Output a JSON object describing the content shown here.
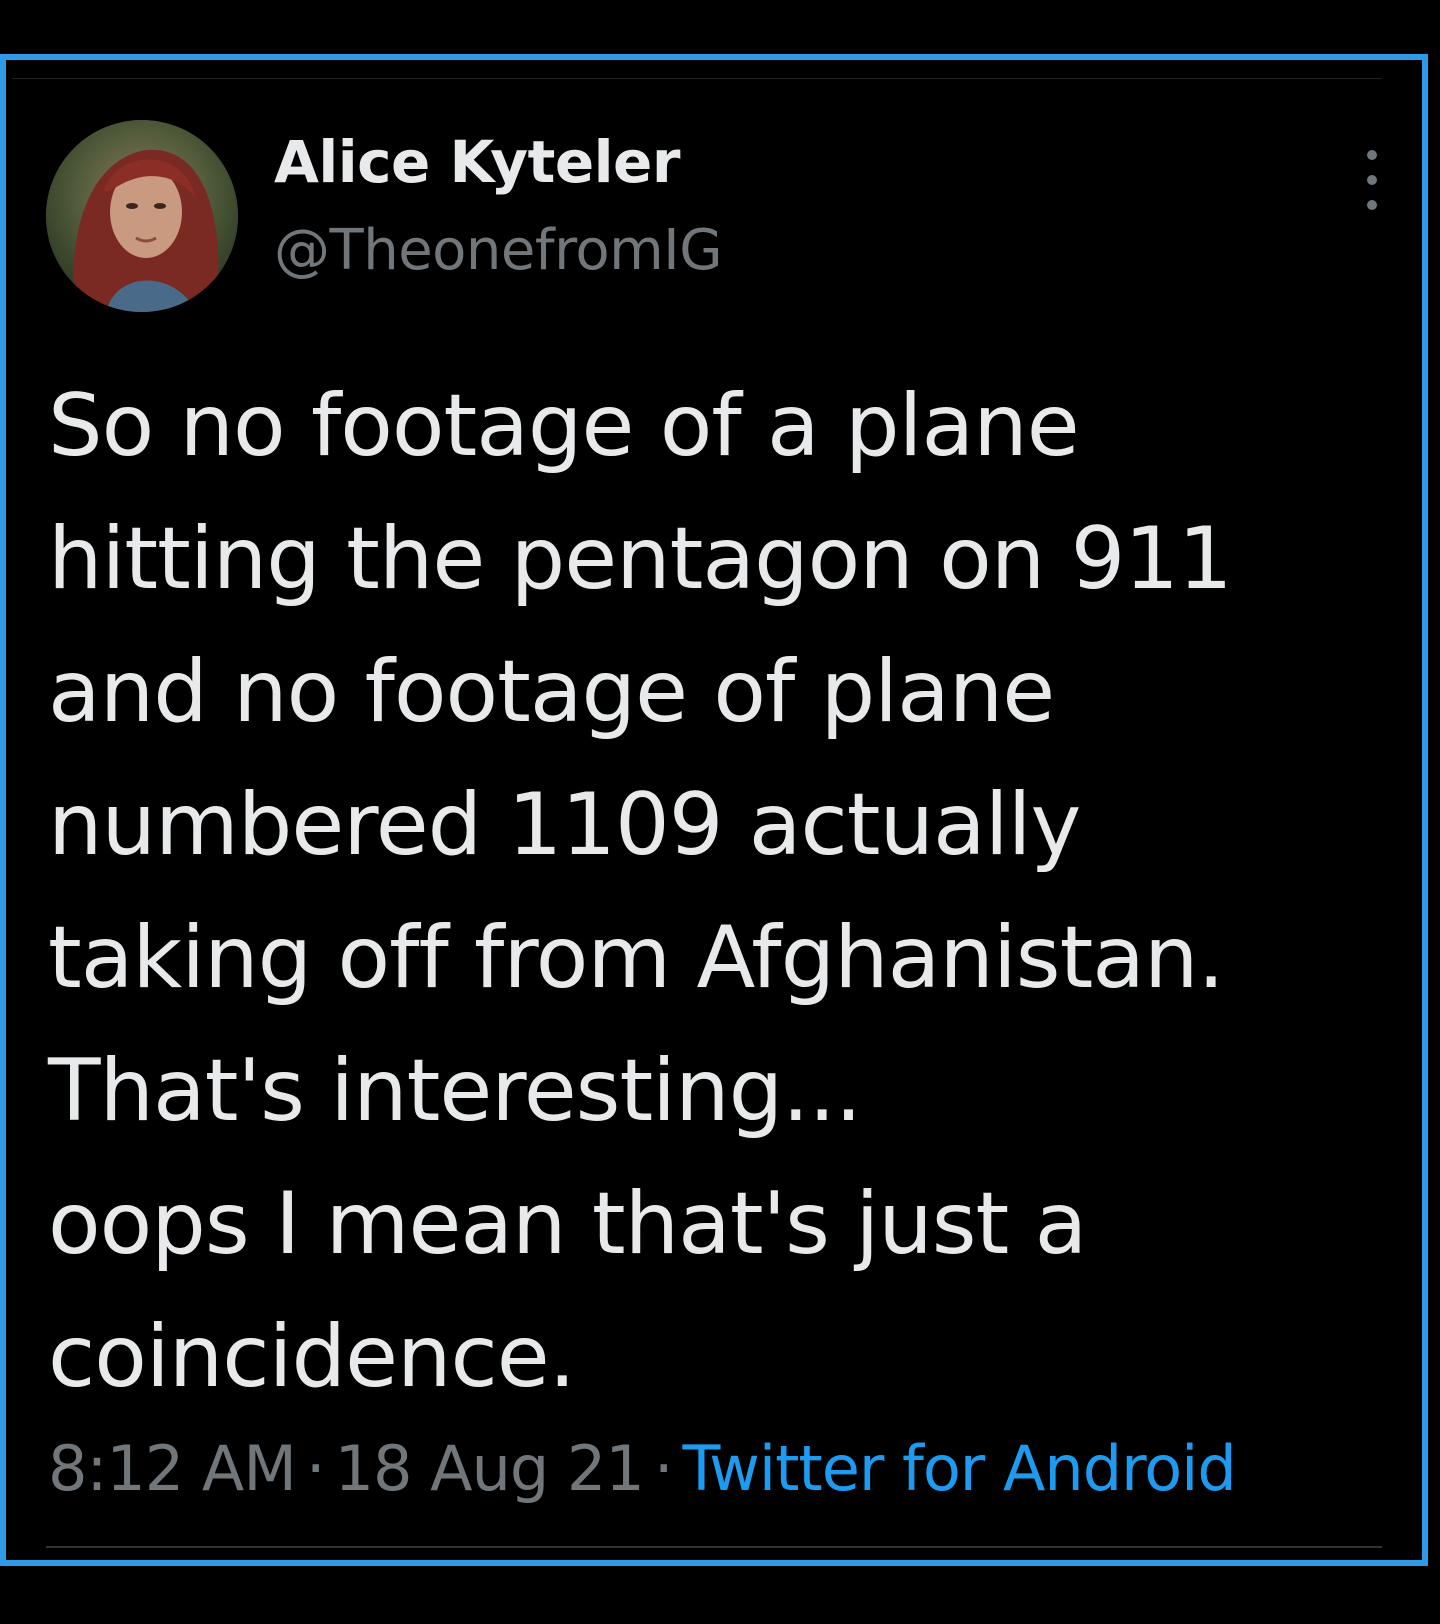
{
  "tweet": {
    "author": {
      "name": "Alice Kyteler",
      "handle": "@TheonefromIG"
    },
    "text_lines": [
      "So no footage of a plane",
      "hitting the pentagon on 911",
      "and no footage of plane",
      "numbered 1109 actually",
      "taking off from Afghanistan.",
      "That's interesting...",
      "oops I mean that's just a",
      "coincidence."
    ],
    "time": "8:12 AM",
    "date": "18 Aug 21",
    "separator": "·",
    "source": "Twitter for Android"
  },
  "icons": {
    "more": "more-vertical-icon",
    "avatar": "profile-photo"
  },
  "colors": {
    "border_accent": "#2f9be8",
    "link": "#1d9bf0",
    "text_primary": "#e7e9ea",
    "text_secondary": "#71767b",
    "background": "#000000"
  }
}
